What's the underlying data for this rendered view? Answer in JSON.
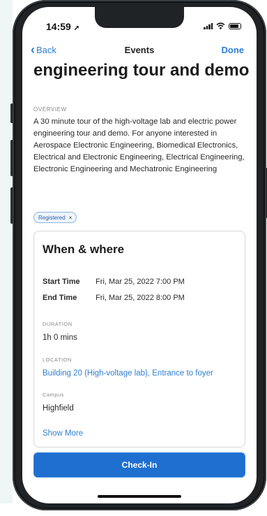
{
  "status_bar": {
    "time": "14:59"
  },
  "nav": {
    "back_label": "Back",
    "title": "Events",
    "done_label": "Done"
  },
  "event": {
    "title": "engineering tour and demo",
    "overview_label": "OVERVIEW",
    "overview_text": "A 30 minute tour of the high-voltage lab and electric power engineering tour and demo. For anyone interested in Aerospace Electronic Engineering, Biomedical Electronics, Electrical and Electronic Engineering, Electrical Engineering, Electronic Engineering and Mechatronic Engineering",
    "tag_label": "Registered",
    "tag_close": "×"
  },
  "when_where": {
    "title": "When & where",
    "start_label": "Start Time",
    "start_value": "Fri, Mar 25, 2022 7:00 PM",
    "end_label": "End Time",
    "end_value": "Fri, Mar 25, 2022 8:00 PM",
    "duration_label": "DURATION",
    "duration_value": "1h 0 mins",
    "location_label": "LOCATION",
    "location_value": "Building 20 (High-voltage lab), Entrance to foyer",
    "campus_label": "Campus",
    "campus_value": "Highfield",
    "show_more": "Show More"
  },
  "actions": {
    "checkin_label": "Check-In"
  },
  "colors": {
    "accent": "#2f7fd3",
    "button": "#1f6fd0",
    "phone_frame": "#1f2326"
  }
}
